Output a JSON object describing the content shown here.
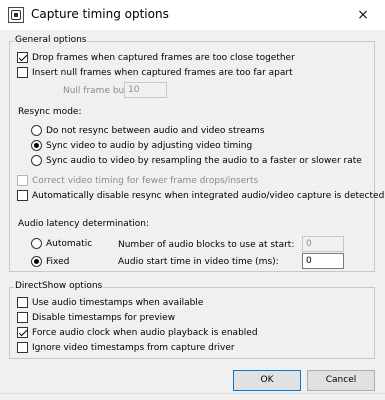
{
  "window": {
    "title": "Capture timing options",
    "close_icon": "×"
  },
  "general": {
    "title": "General options",
    "drop_frames": "Drop frames when captured frames are too close together",
    "insert_null": "Insert null frames when captured frames are too far apart",
    "burst_label": "Null frame burst limit:",
    "burst_value": "10",
    "resync_label": "Resync mode:",
    "resync_options": [
      "Do not resync between audio and video streams",
      "Sync video to audio by adjusting video timing",
      "Sync audio to video by resampling the audio to a faster or slower rate"
    ],
    "correct_timing": "Correct video timing for fewer frame drops/inserts",
    "auto_disable": "Automatically disable resync when integrated audio/video capture is detected",
    "latency_label": "Audio latency determination:",
    "latency_automatic": "Automatic",
    "latency_fixed": "Fixed",
    "blocks_label": "Number of audio blocks to use at start:",
    "blocks_value": "0",
    "start_time_label": "Audio start time in video time (ms):",
    "start_time_value": "0"
  },
  "directshow": {
    "title": "DirectShow options",
    "items": [
      "Use audio timestamps when available",
      "Disable timestamps for preview",
      "Force audio clock when audio playback is enabled",
      "Ignore video timestamps from capture driver"
    ]
  },
  "buttons": {
    "ok": "OK",
    "cancel": "Cancel"
  }
}
